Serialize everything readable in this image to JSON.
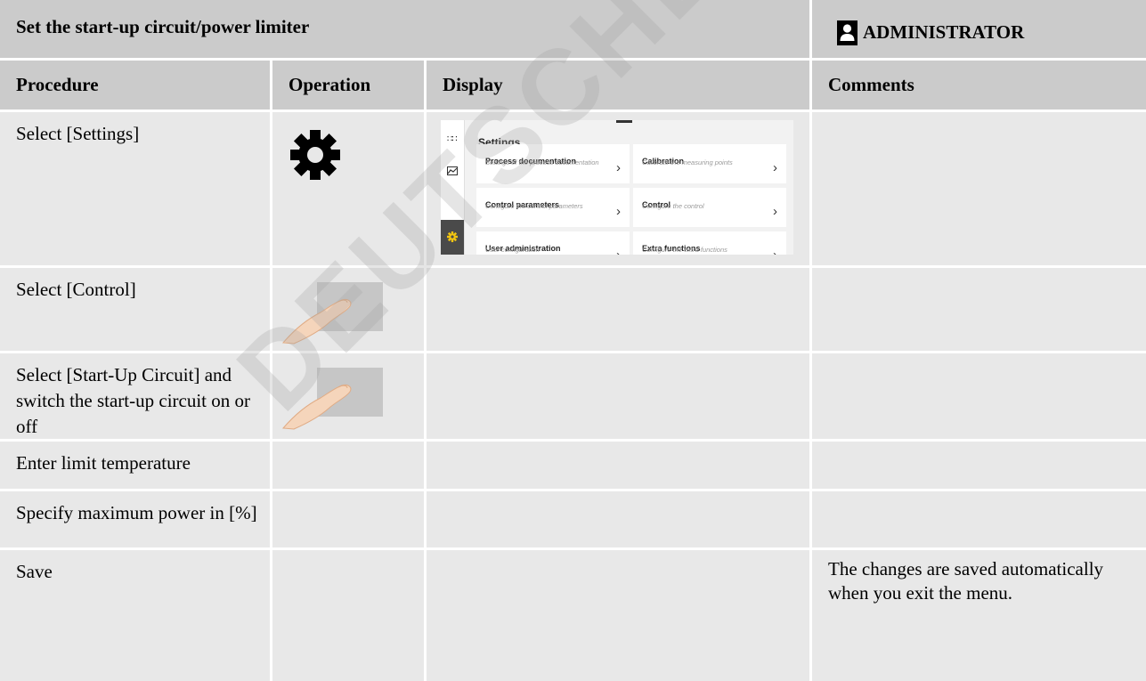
{
  "header": {
    "title": "Set the start-up circuit/power limiter",
    "role": "ADMINISTRATOR",
    "role_icon": "user-icon"
  },
  "columns": {
    "procedure": "Procedure",
    "operation": "Operation",
    "display": "Display",
    "comments": "Comments"
  },
  "rows": [
    {
      "procedure": "Select [Settings]",
      "operation_icon": "gear-icon",
      "comments": ""
    },
    {
      "procedure": "Select [Control]",
      "operation_icon": "finger-tap-icon",
      "comments": ""
    },
    {
      "procedure": "Select [Start-Up Circuit] and switch the start-up circuit on or off",
      "operation_icon": "finger-tap-icon",
      "comments": ""
    },
    {
      "procedure": "Enter limit temperature",
      "operation_icon": "",
      "comments": ""
    },
    {
      "procedure": "Specify maximum power in [%]",
      "operation_icon": "",
      "comments": ""
    },
    {
      "procedure": "Save",
      "operation_icon": "",
      "comments": "The changes are saved automatically when you exit the menu."
    }
  ],
  "settings_screen": {
    "title": "Settings",
    "active_color": "#f2c511",
    "tiles": [
      {
        "title": "Process documentation",
        "subtitle": "Settings of the process documentation"
      },
      {
        "title": "Calibration",
        "subtitle": "Calibrate the measuring points"
      },
      {
        "title": "Control parameters",
        "subtitle": "Configure the control parameters"
      },
      {
        "title": "Control",
        "subtitle": "Configure the control"
      },
      {
        "title": "User administration",
        "subtitle": "User configuration"
      },
      {
        "title": "Extra functions",
        "subtitle": "Configure the extra functions"
      }
    ]
  },
  "watermark": "DEUTSCHER SAS"
}
